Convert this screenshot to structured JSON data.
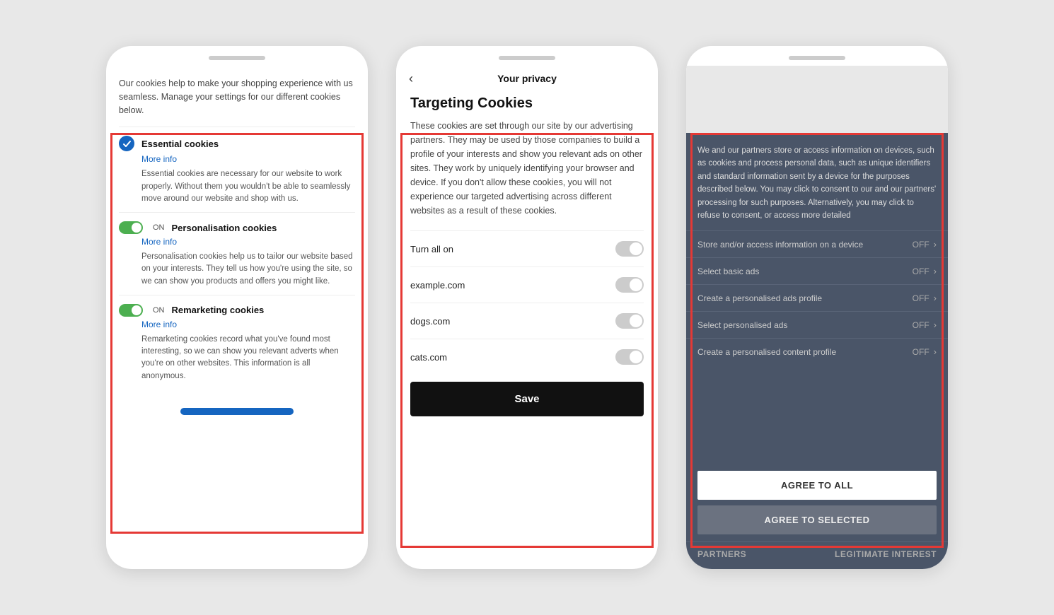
{
  "phone1": {
    "intro": "Our cookies help to make your shopping experience with us seamless. Manage your settings for our different cookies below.",
    "sections": [
      {
        "type": "check",
        "title": "Essential cookies",
        "moreInfo": "More info",
        "desc": "Essential cookies are necessary for our website to work properly. Without them you wouldn't be able to seamlessly move around our website and shop with us."
      },
      {
        "type": "toggle",
        "title": "Personalisation cookies",
        "onLabel": "ON",
        "moreInfo": "More info",
        "desc": "Personalisation cookies help us to tailor our website based on your interests. They tell us how you're using the site, so we can show you products and offers you might like."
      },
      {
        "type": "toggle",
        "title": "Remarketing cookies",
        "onLabel": "ON",
        "moreInfo": "More info",
        "desc": "Remarketing cookies record what you've found most interesting, so we can show you relevant adverts when you're on other websites. This information is all anonymous."
      }
    ]
  },
  "phone2": {
    "backLabel": "‹",
    "title": "Your privacy",
    "targetingTitle": "Targeting Cookies",
    "desc": "These cookies are set through our site by our advertising partners. They may be used by those companies to build a profile of your interests and show you relevant ads on other sites. They work by uniquely identifying your browser and device. If you don't allow these cookies, you will not experience our targeted advertising across different websites as a result of these cookies.",
    "rows": [
      {
        "label": "Turn all on"
      },
      {
        "label": "example.com"
      },
      {
        "label": "dogs.com"
      },
      {
        "label": "cats.com"
      }
    ],
    "saveLabel": "Save"
  },
  "phone3": {
    "introText": "We and our partners store or access information on devices, such as cookies and process personal data, such as unique identifiers and standard information sent by a device for the purposes described below. You may click to consent to our and our partners' processing for such purposes. Alternatively, you may click to refuse to consent, or access more detailed",
    "rows": [
      {
        "label": "Store and/or access information on a device",
        "status": "OFF"
      },
      {
        "label": "Select basic ads",
        "status": "OFF"
      },
      {
        "label": "Create a personalised ads profile",
        "status": "OFF"
      },
      {
        "label": "Select personalised ads",
        "status": "OFF"
      },
      {
        "label": "Create a personalised content profile",
        "status": "OFF"
      }
    ],
    "agreeAllLabel": "AGREE TO ALL",
    "agreeSelectedLabel": "AGREE TO SELECTED",
    "footerLeft": "PARTNERS",
    "footerRight": "LEGITIMATE INTEREST"
  }
}
